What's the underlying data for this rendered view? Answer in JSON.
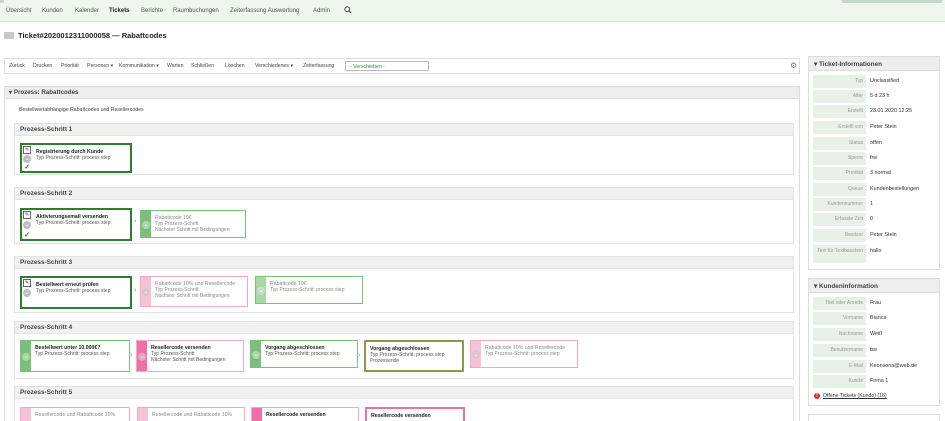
{
  "nav": {
    "items": [
      "Übersicht",
      "Kunden",
      "Kalender",
      "Tickets",
      "Berichte",
      "Raumbuchungen",
      "Zeiterfassung Auswertung",
      "Admin"
    ],
    "active": "Tickets",
    "search_icon": "search-icon"
  },
  "ticket": {
    "title": "Ticket#2020012311000058 — Rabattcodes"
  },
  "toolbar": {
    "items": [
      "Zurück",
      "Drucken",
      "Priorität",
      "Personen ▾",
      "Kommunikation ▾",
      "Warten",
      "Schließen",
      "Löschen",
      "Verschiedenes ▾",
      "Zeiterfassung"
    ],
    "move_select": "- Verschieben -",
    "settings_icon": "gear-icon"
  },
  "process": {
    "header": "▾ Prozess: Rabattcodes",
    "description": "Bestellwertabhängige Rabattcodes und Resellercodes",
    "steps": [
      {
        "label": "Prozess-Schritt 1",
        "cards": [
          {
            "t1": "Registrierung durch Kunde",
            "t2": "Typ Prozess-Schritt: process step",
            "t3": ""
          }
        ]
      },
      {
        "label": "Prozess-Schritt 2",
        "cards": [
          {
            "t1": "Aktivierungsemail versenden",
            "t2": "Typ Prozess-Schritt: process step",
            "t3": ""
          },
          {
            "t1": "Rabattcode 10€",
            "t2": "Typ Prozess-Schritt",
            "t3": "Nächster Schritt mit Bedingungen"
          }
        ]
      },
      {
        "label": "Prozess-Schritt 3",
        "cards": [
          {
            "t1": "Bestellwert erneut prüfen",
            "t2": "Typ Prozess-Schritt: process step",
            "t3": ""
          },
          {
            "t1": "Rabattcode 10% und Resellercode",
            "t2": "Typ Prozess-Schritt",
            "t3": "Nächster Schritt mit Bedingungen"
          },
          {
            "t1": "Rabattcode 10€",
            "t2": "Typ Prozess-Schritt: process step",
            "t3": ""
          }
        ]
      },
      {
        "label": "Prozess-Schritt 4",
        "cards": [
          {
            "t1": "Bestellwert unter 10.000€?",
            "t2": "Typ Prozess-Schritt: process step",
            "t3": ""
          },
          {
            "t1": "Resellercode versenden",
            "t2": "Typ Prozess-Schritt",
            "t3": "Nächster Schritt mit Bedingungen"
          },
          {
            "t1": "Vorgang abgeschlossen",
            "t2": "Typ Prozess-Schritt: process step",
            "t3": ""
          },
          {
            "t1": "Vorgang abgeschlossen",
            "t2": "Typ Prozess-Schritt: process step",
            "t3": "Prozessende"
          },
          {
            "t1": "Rabattcode 10% und Resellercode",
            "t2": "Typ Prozess-Schritt: process step",
            "t3": ""
          }
        ]
      },
      {
        "label": "Prozess-Schritt 5",
        "cards": [
          {
            "t1": "Resellercode und Rabattcode 10%",
            "t2": "",
            "t3": ""
          },
          {
            "t1": "Resellercode und Rabattcode 10%",
            "t2": "",
            "t3": ""
          },
          {
            "t1": "Resellercode versenden",
            "t2": "",
            "t3": ""
          },
          {
            "t1": "Resellercode versenden",
            "t2": "",
            "t3": ""
          }
        ]
      }
    ]
  },
  "ticket_info": {
    "header": "▾ Ticket-Informationen",
    "rows": [
      {
        "k": "Typ",
        "v": "Unclassified"
      },
      {
        "k": "Alter",
        "v": "5 d 23 h"
      },
      {
        "k": "Erstellt",
        "v": "23.01.2020 12:25"
      },
      {
        "k": "Erstellt von",
        "v": "Peter Stein"
      },
      {
        "k": "Status",
        "v": "offen"
      },
      {
        "k": "Sperre",
        "v": "frei"
      },
      {
        "k": "Priorität",
        "v": "3 normal"
      },
      {
        "k": "Queue",
        "v": "Kundenbestellungen"
      },
      {
        "k": "Kundennummer",
        "v": "1"
      },
      {
        "k": "Erfasste Zeit",
        "v": "0"
      },
      {
        "k": "Besitzer",
        "v": "Peter Stein"
      },
      {
        "k": "Text für Textbaustein",
        "v": "hallo"
      }
    ]
  },
  "customer_info": {
    "header": "▾ Kundeninformation",
    "rows": [
      {
        "k": "Titel oder Anrede",
        "v": "Frau"
      },
      {
        "k": "Vorname",
        "v": "Bianca"
      },
      {
        "k": "Nachname",
        "v": "Weiß"
      },
      {
        "k": "Benutzername",
        "v": "bw"
      },
      {
        "k": "E-Mail",
        "v": "Keonsona@web.de"
      },
      {
        "k": "Kunde",
        "v": "Firma 1"
      }
    ],
    "open_tickets": "Offene Tickets (Kunde) (16)"
  },
  "colors": {
    "active": "#2e7d32",
    "done": "#7cbf7c",
    "pending": "#f06fa5",
    "end": "#8a9a4a"
  }
}
